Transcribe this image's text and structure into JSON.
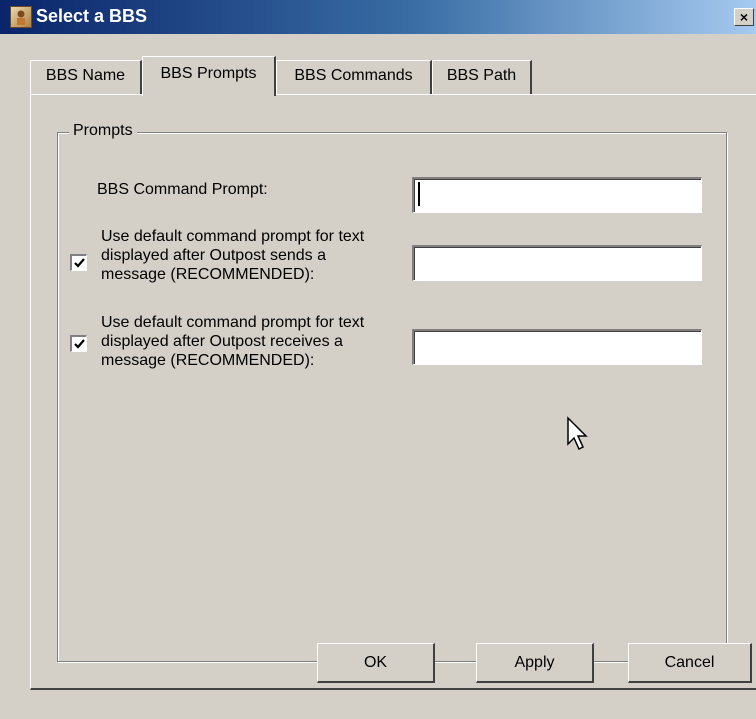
{
  "window": {
    "title": "Select a BBS",
    "close_label": "×"
  },
  "tabs": [
    {
      "label": "BBS Name",
      "active": false
    },
    {
      "label": "BBS Prompts",
      "active": true
    },
    {
      "label": "BBS Commands",
      "active": false
    },
    {
      "label": "BBS Path",
      "active": false
    }
  ],
  "group": {
    "legend": "Prompts"
  },
  "fields": {
    "command_prompt": {
      "label": "BBS Command Prompt:",
      "value": ""
    },
    "after_send": {
      "checked": true,
      "label_lines": [
        "Use default command prompt for text",
        "displayed after Outpost sends a",
        "message (RECOMMENDED):"
      ],
      "value": ""
    },
    "after_receive": {
      "checked": true,
      "label_lines": [
        "Use default command prompt for text",
        "displayed after Outpost receives a",
        "message (RECOMMENDED):"
      ],
      "value": ""
    }
  },
  "buttons": {
    "ok": "OK",
    "apply": "Apply",
    "cancel": "Cancel"
  }
}
